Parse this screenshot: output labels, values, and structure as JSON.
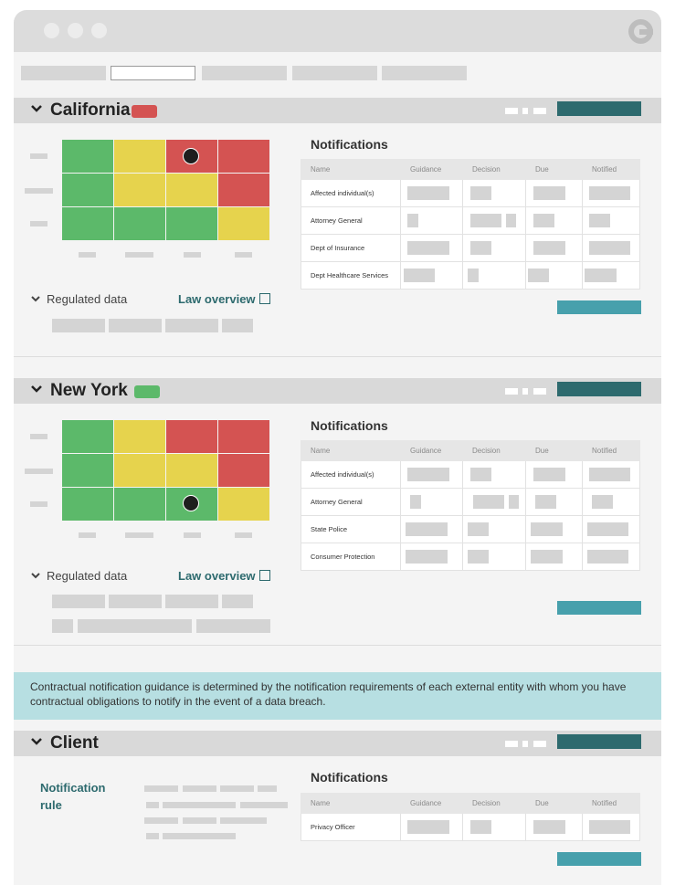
{
  "window": {
    "app_icon": "refresh-logo-icon"
  },
  "tabs": [
    {
      "active": false
    },
    {
      "active": true
    },
    {
      "active": false
    },
    {
      "active": false
    },
    {
      "active": false
    }
  ],
  "colors": {
    "accent_dark": "#2d6a6e",
    "accent_light": "#47a0ac",
    "risk_high": "#d45352",
    "risk_medium": "#e6d34d",
    "risk_low": "#5cb96a",
    "info_banner": "#b7dfe2"
  },
  "states": [
    {
      "name": "California",
      "badge_color": "#d45352",
      "heatmap": {
        "rows": [
          [
            "green",
            "yellow",
            "red",
            "red"
          ],
          [
            "green",
            "yellow",
            "yellow",
            "red"
          ],
          [
            "green",
            "green",
            "green",
            "yellow"
          ]
        ],
        "marker": {
          "row": 0,
          "col": 2
        }
      },
      "regulated_data_label": "Regulated data",
      "law_overview_label": "Law overview",
      "notifications": {
        "title": "Notifications",
        "columns": [
          "Name",
          "Guidance",
          "Decision",
          "Due",
          "Notified"
        ],
        "rows": [
          "Affected individual(s)",
          "Attorney General",
          "Dept of Insurance",
          "Dept Healthcare Services"
        ]
      }
    },
    {
      "name": "New York",
      "badge_color": "#5cb96a",
      "heatmap": {
        "rows": [
          [
            "green",
            "yellow",
            "red",
            "red"
          ],
          [
            "green",
            "yellow",
            "yellow",
            "red"
          ],
          [
            "green",
            "green",
            "green",
            "yellow"
          ]
        ],
        "marker": {
          "row": 2,
          "col": 2
        }
      },
      "regulated_data_label": "Regulated data",
      "law_overview_label": "Law overview",
      "notifications": {
        "title": "Notifications",
        "columns": [
          "Name",
          "Guidance",
          "Decision",
          "Due",
          "Notified"
        ],
        "rows": [
          "Affected individual(s)",
          "Attorney General",
          "State Police",
          "Consumer Protection"
        ]
      }
    }
  ],
  "contract_info": "Contractual notification guidance is determined by the notification requirements of each external entity with whom you have contractual obligations to notify in the event of a data breach.",
  "client": {
    "name": "Client",
    "rule_label": "Notification rule",
    "notifications": {
      "title": "Notifications",
      "columns": [
        "Name",
        "Guidance",
        "Decision",
        "Due",
        "Notified"
      ],
      "rows": [
        "Privacy Officer"
      ]
    }
  }
}
